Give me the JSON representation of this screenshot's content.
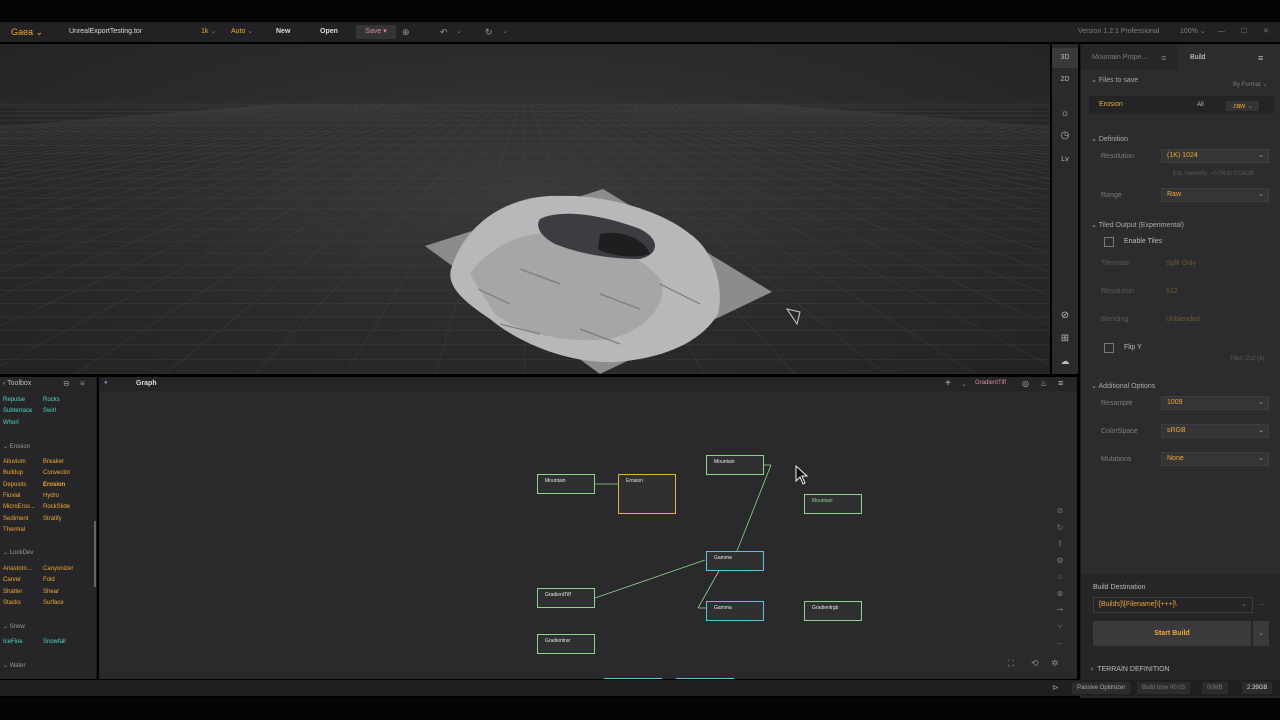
{
  "titlebar": {
    "app_name": "Gaea",
    "file_name": "UnrealExportTesting.tor",
    "resolution": "1k",
    "mode": "Auto",
    "new_label": "New",
    "open_label": "Open",
    "save_label": "Save",
    "version": "Version 1.2.1 Professional",
    "zoom": "100%"
  },
  "view_toolbar": {
    "btn_3d": "3D",
    "btn_2d": "2D",
    "btn_lv": "Lv"
  },
  "props": {
    "tab_properties": "Mountain Prope...",
    "tab_build": "Build",
    "files_to_save": "Files to save",
    "by_format": "By Format",
    "file_item": "Erosion",
    "all_label": "All",
    "format": ".raw",
    "definition": "Definition",
    "resolution_label": "Resolution",
    "resolution_value": "(1K) 1024",
    "est_memory": "Est. memory: ~0.04 to 0.08GB",
    "range_label": "Range",
    "range_value": "Raw",
    "tiled_output": "Tiled Output (Experimental)",
    "enable_tiles": "Enable Tiles",
    "tiled_label": "Tilemode",
    "tiled_value": "Split Only",
    "tile_res_label": "Resolution",
    "tile_res_value": "512",
    "blending_label": "Blending",
    "blending_value": "Unblended",
    "flip_y": "Flip Y",
    "tiles_info": "Tiles: 2x2 (4)",
    "additional_options": "Additional Options",
    "resample_label": "Resample",
    "resample_value": "1009",
    "colorspace_label": "ColorSpace",
    "colorspace_value": "sRGB",
    "mutations_label": "Mutations",
    "mutations_value": "None",
    "build_destination": "Build Destination",
    "build_destination_value": "[Builds]\\[Filename]\\[+++]\\",
    "start_build": "Start Build",
    "terrain_definition": "TERRAIN DEFINITION"
  },
  "toolbox": {
    "title": "Toolbox",
    "simulate_items": [
      "Repulse",
      "Rocks",
      "Subterrace",
      "Swirl",
      "Whorl"
    ],
    "erosion_category": "Erosion",
    "erosion_items": [
      "Alluvium",
      "Breaker",
      "Buildup",
      "Convector",
      "Deposits",
      "Erosion",
      "Fluvial",
      "Hydro",
      "MicroEros...",
      "RockSlide",
      "Sediment",
      "Stratify",
      "Thermal"
    ],
    "lookdev_category": "LookDev",
    "lookdev_items": [
      "Anastom...",
      "Canyonizer",
      "Carver",
      "Fold",
      "Shatter",
      "Shear",
      "Stacks",
      "Surface"
    ],
    "snow_category": "Snow",
    "snow_items": [
      "IceFloe",
      "Snowfall"
    ],
    "water_category": "Water"
  },
  "graph": {
    "tab_label": "Graph",
    "gradient_label": "GradientTiff",
    "nodes": {
      "mountain1": "Mountain",
      "erosion": "Erosion",
      "mountain2": "Mountain",
      "mountain3": "Mountain",
      "gamma1": "Gamma",
      "gradienttiff": "GradientTiff",
      "gamma2": "Gamma",
      "gradientrgb": "Gradientrgb",
      "gradientrar": "Gradientrar"
    }
  },
  "statusbar": {
    "passive": "Passive Optimizer",
    "build_time": "Build time 00:05",
    "memory1": "00MB",
    "memory2": "2.39GB"
  }
}
